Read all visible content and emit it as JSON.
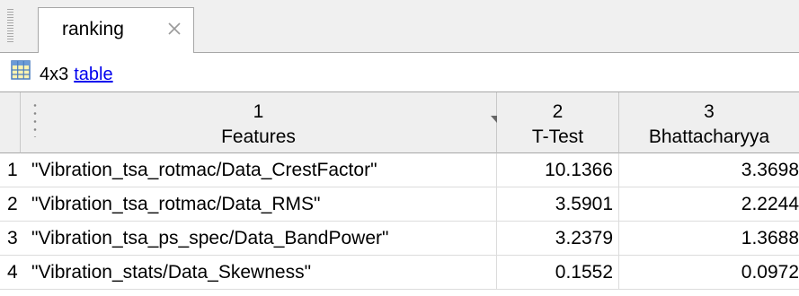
{
  "tab": {
    "label": "ranking"
  },
  "info": {
    "size": "4x3",
    "link": "table"
  },
  "columns": [
    {
      "num": "1",
      "name": "Features"
    },
    {
      "num": "2",
      "name": "T-Test"
    },
    {
      "num": "3",
      "name": "Bhattacharyya"
    }
  ],
  "rows": [
    {
      "idx": "1",
      "feature": "\"Vibration_tsa_rotmac/Data_CrestFactor\"",
      "ttest": "10.1366",
      "bhatt": "3.3698"
    },
    {
      "idx": "2",
      "feature": "\"Vibration_tsa_rotmac/Data_RMS\"",
      "ttest": "3.5901",
      "bhatt": "2.2244"
    },
    {
      "idx": "3",
      "feature": "\"Vibration_tsa_ps_spec/Data_BandPower\"",
      "ttest": "3.2379",
      "bhatt": "1.3688"
    },
    {
      "idx": "4",
      "feature": "\"Vibration_stats/Data_Skewness\"",
      "ttest": "0.1552",
      "bhatt": "0.0972"
    }
  ],
  "icons": {
    "tab_close": "close-icon",
    "table": "table-icon",
    "sort": "sort-arrow-icon"
  },
  "colors": {
    "link": "#0000ee",
    "header_bg": "#efefef",
    "strip_bg": "#f0f0f0"
  }
}
